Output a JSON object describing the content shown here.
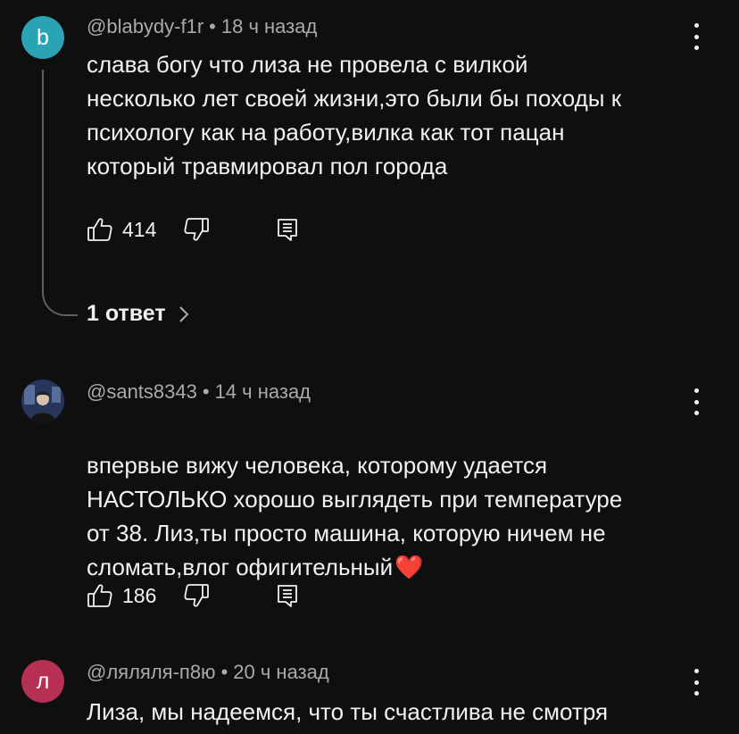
{
  "comments": [
    {
      "author": "@blabydy-f1r",
      "time": "18 ч назад",
      "avatar_letter": "b",
      "avatar_color": "#2aa3b4",
      "text": "слава богу что лиза не провела с вилкой\nнесколько лет своей жизни,это были бы походы к\nпсихологу как на работу,вилка как тот пацан\nкоторый травмировал пол города",
      "likes": "414",
      "replies_label": "1 ответ"
    },
    {
      "author": "@sants8343",
      "time": "14 ч назад",
      "text": "впервые вижу человека, которому удается\nНАСТОЛЬКО хорошо выглядеть при температуре\nот 38. Лиз,ты просто машина, которую ничем не\nсломать,влог офигительный",
      "emoji": "❤️",
      "likes": "186"
    },
    {
      "author": "@ляляля-п8ю",
      "time": "20 ч назад",
      "avatar_letter": "л",
      "avatar_color": "#b62f55",
      "text": "Лиза, мы надеемся, что ты счастлива не смотря"
    }
  ],
  "separator": "•",
  "icons": {
    "like": "thumbs-up-icon",
    "dislike": "thumbs-down-icon",
    "reply": "reply-comment-icon",
    "more": "more-vertical-icon",
    "chevron": "chevron-right-icon"
  }
}
